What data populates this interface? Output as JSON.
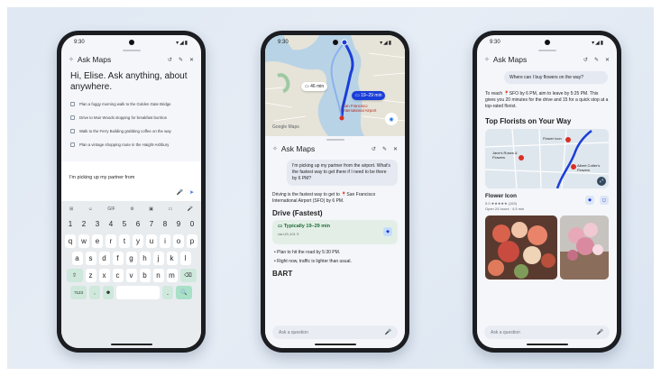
{
  "phones": [
    {
      "time": "9:30",
      "status_icons": "▾◢▮",
      "sheet_title": "Ask Maps",
      "greeting": "Hi, Elise. Ask anything, about anywhere.",
      "suggestions": [
        "Plan a foggy morning walk to the Golden Gate Bridge",
        "Drive to Muir Woods stopping for breakfast burritos",
        "Walk to the Ferry Building grabbing coffee on the way",
        "Plan a vintage shopping route in the Haight-Ashbury"
      ],
      "input_value": "I'm picking up my partner from",
      "keyboard": {
        "tools": [
          "⊞",
          "☺",
          "GIF",
          "⚙",
          "▣",
          "▭",
          "🎤"
        ],
        "num_row": [
          "1",
          "2",
          "3",
          "4",
          "5",
          "6",
          "7",
          "8",
          "9",
          "0"
        ],
        "row1": [
          "q",
          "w",
          "e",
          "r",
          "t",
          "y",
          "u",
          "i",
          "o",
          "p"
        ],
        "row2": [
          "a",
          "s",
          "d",
          "f",
          "g",
          "h",
          "j",
          "k",
          "l"
        ],
        "row3": [
          "z",
          "x",
          "c",
          "v",
          "b",
          "n",
          "m"
        ],
        "shift": "⇧",
        "backspace": "⌫",
        "symbols": "?123",
        "comma": ",",
        "emoji": "☻",
        "period": ".",
        "search": "🔍"
      }
    },
    {
      "time": "9:30",
      "status_icons": "▾◢▮",
      "map": {
        "chip_alt": "46 min",
        "chip_selected": "19–29 min",
        "airport_label": "San Francisco International Airport",
        "logo": "Google Maps"
      },
      "sheet_title": "Ask Maps",
      "user_message": "I'm picking up my partner from the airport. What's the fastest way to get there if I need to be there by 6 PM?",
      "answer": "Driving is the fastest way to get to 📍San Francisco International Airport (SFO) by 6 PM.",
      "drive_heading": "Drive (Fastest)",
      "route": {
        "time": "Typically 19–29 min",
        "via": "via US-101 S"
      },
      "bullets": [
        "Plan to hit the road by 5:30 PM.",
        "Right now, traffic is lighter than usual."
      ],
      "bart_heading": "BART",
      "ask_placeholder": "Ask a question"
    },
    {
      "time": "9:30",
      "status_icons": "▾◢▮",
      "sheet_title": "Ask Maps",
      "user_message": "Where can I buy flowers on the way?",
      "answer": "To reach 📍SFO by 6 PM, aim to leave by 5:25 PM. This gives you 20 minutes for the drive and 15 for a quick stop at a top-rated florist.",
      "heading": "Top Florists on Your Way",
      "map_labels": [
        "Flower Icon",
        "Jane's Roses & Flowers",
        "Albert Cotter's Flowers"
      ],
      "place": {
        "name": "Flower Icon",
        "rating": "5.0 ★★★★★ (153)",
        "hours": "Open 24 hours · 4.5 min"
      },
      "ask_placeholder": "Ask a question"
    }
  ],
  "colors": {
    "accent": "#1a3ed8",
    "route_green": "#1e6b3a",
    "keyboard_green": "#cfe8dc"
  }
}
